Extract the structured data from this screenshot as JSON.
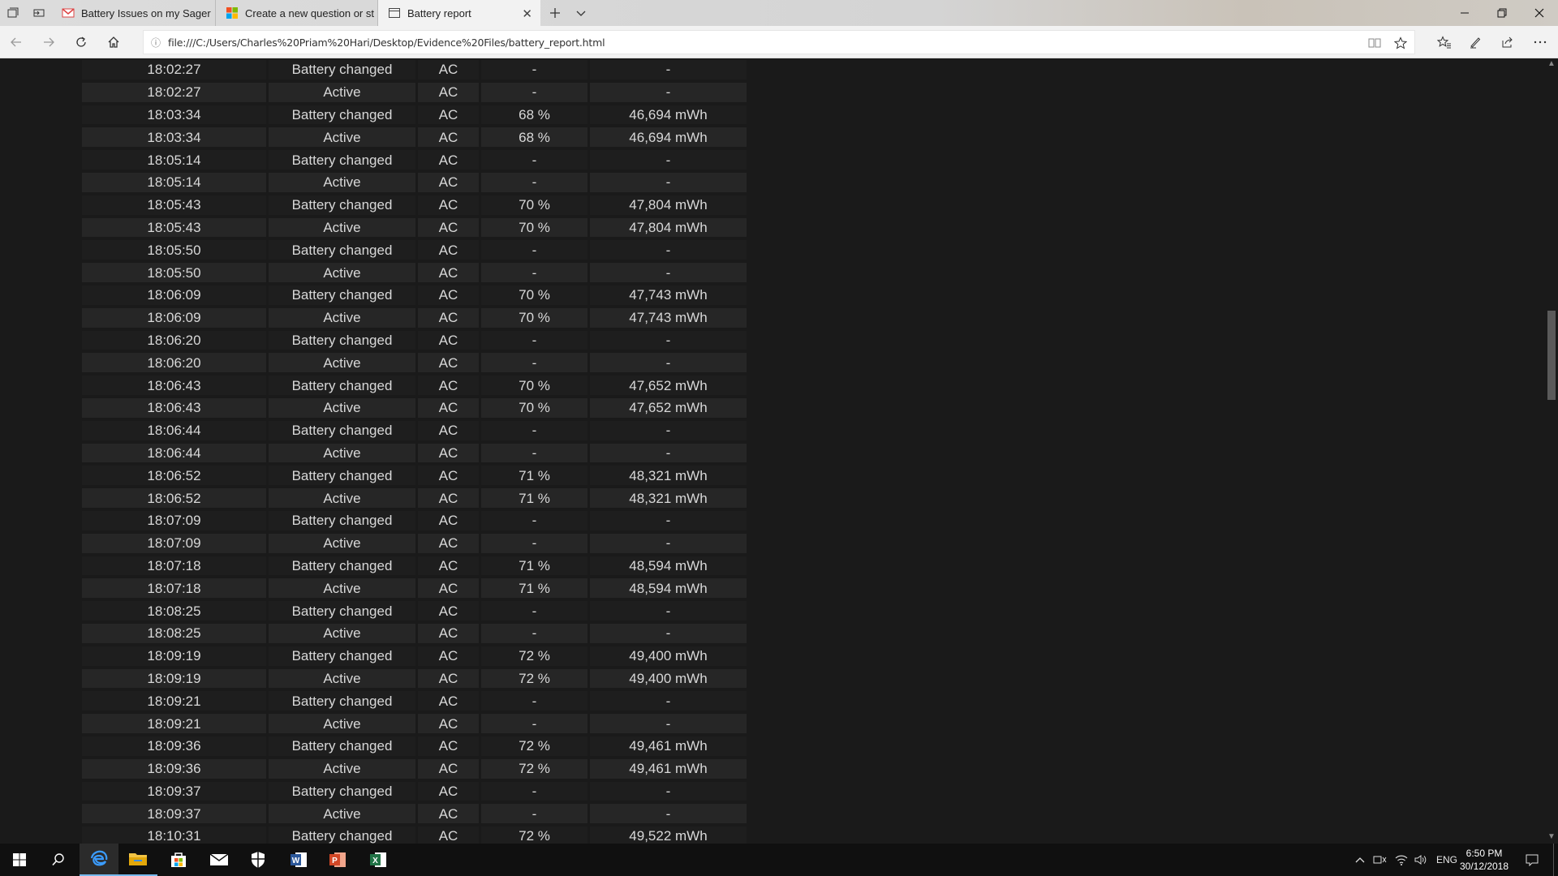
{
  "browser": {
    "tabs": [
      {
        "title": "Battery Issues on my Sager",
        "icon": "gmail-icon"
      },
      {
        "title": "Create a new question or st",
        "icon": "microsoft-icon"
      },
      {
        "title": "Battery report",
        "icon": "page-icon"
      }
    ],
    "url": "file:///C:/Users/Charles%20Priam%20Hari/Desktop/Evidence%20Files/battery_report.html"
  },
  "report": {
    "rows": [
      {
        "time": "18:02:27",
        "state": "Battery changed",
        "source": "AC",
        "percent": "-",
        "capacity": "-"
      },
      {
        "time": "18:02:27",
        "state": "Active",
        "source": "AC",
        "percent": "-",
        "capacity": "-"
      },
      {
        "time": "18:03:34",
        "state": "Battery changed",
        "source": "AC",
        "percent": "68 %",
        "capacity": "46,694 mWh"
      },
      {
        "time": "18:03:34",
        "state": "Active",
        "source": "AC",
        "percent": "68 %",
        "capacity": "46,694 mWh"
      },
      {
        "time": "18:05:14",
        "state": "Battery changed",
        "source": "AC",
        "percent": "-",
        "capacity": "-"
      },
      {
        "time": "18:05:14",
        "state": "Active",
        "source": "AC",
        "percent": "-",
        "capacity": "-"
      },
      {
        "time": "18:05:43",
        "state": "Battery changed",
        "source": "AC",
        "percent": "70 %",
        "capacity": "47,804 mWh"
      },
      {
        "time": "18:05:43",
        "state": "Active",
        "source": "AC",
        "percent": "70 %",
        "capacity": "47,804 mWh"
      },
      {
        "time": "18:05:50",
        "state": "Battery changed",
        "source": "AC",
        "percent": "-",
        "capacity": "-"
      },
      {
        "time": "18:05:50",
        "state": "Active",
        "source": "AC",
        "percent": "-",
        "capacity": "-"
      },
      {
        "time": "18:06:09",
        "state": "Battery changed",
        "source": "AC",
        "percent": "70 %",
        "capacity": "47,743 mWh"
      },
      {
        "time": "18:06:09",
        "state": "Active",
        "source": "AC",
        "percent": "70 %",
        "capacity": "47,743 mWh"
      },
      {
        "time": "18:06:20",
        "state": "Battery changed",
        "source": "AC",
        "percent": "-",
        "capacity": "-"
      },
      {
        "time": "18:06:20",
        "state": "Active",
        "source": "AC",
        "percent": "-",
        "capacity": "-"
      },
      {
        "time": "18:06:43",
        "state": "Battery changed",
        "source": "AC",
        "percent": "70 %",
        "capacity": "47,652 mWh"
      },
      {
        "time": "18:06:43",
        "state": "Active",
        "source": "AC",
        "percent": "70 %",
        "capacity": "47,652 mWh"
      },
      {
        "time": "18:06:44",
        "state": "Battery changed",
        "source": "AC",
        "percent": "-",
        "capacity": "-"
      },
      {
        "time": "18:06:44",
        "state": "Active",
        "source": "AC",
        "percent": "-",
        "capacity": "-"
      },
      {
        "time": "18:06:52",
        "state": "Battery changed",
        "source": "AC",
        "percent": "71 %",
        "capacity": "48,321 mWh"
      },
      {
        "time": "18:06:52",
        "state": "Active",
        "source": "AC",
        "percent": "71 %",
        "capacity": "48,321 mWh"
      },
      {
        "time": "18:07:09",
        "state": "Battery changed",
        "source": "AC",
        "percent": "-",
        "capacity": "-"
      },
      {
        "time": "18:07:09",
        "state": "Active",
        "source": "AC",
        "percent": "-",
        "capacity": "-"
      },
      {
        "time": "18:07:18",
        "state": "Battery changed",
        "source": "AC",
        "percent": "71 %",
        "capacity": "48,594 mWh"
      },
      {
        "time": "18:07:18",
        "state": "Active",
        "source": "AC",
        "percent": "71 %",
        "capacity": "48,594 mWh"
      },
      {
        "time": "18:08:25",
        "state": "Battery changed",
        "source": "AC",
        "percent": "-",
        "capacity": "-"
      },
      {
        "time": "18:08:25",
        "state": "Active",
        "source": "AC",
        "percent": "-",
        "capacity": "-"
      },
      {
        "time": "18:09:19",
        "state": "Battery changed",
        "source": "AC",
        "percent": "72 %",
        "capacity": "49,400 mWh"
      },
      {
        "time": "18:09:19",
        "state": "Active",
        "source": "AC",
        "percent": "72 %",
        "capacity": "49,400 mWh"
      },
      {
        "time": "18:09:21",
        "state": "Battery changed",
        "source": "AC",
        "percent": "-",
        "capacity": "-"
      },
      {
        "time": "18:09:21",
        "state": "Active",
        "source": "AC",
        "percent": "-",
        "capacity": "-"
      },
      {
        "time": "18:09:36",
        "state": "Battery changed",
        "source": "AC",
        "percent": "72 %",
        "capacity": "49,461 mWh"
      },
      {
        "time": "18:09:36",
        "state": "Active",
        "source": "AC",
        "percent": "72 %",
        "capacity": "49,461 mWh"
      },
      {
        "time": "18:09:37",
        "state": "Battery changed",
        "source": "AC",
        "percent": "-",
        "capacity": "-"
      },
      {
        "time": "18:09:37",
        "state": "Active",
        "source": "AC",
        "percent": "-",
        "capacity": "-"
      },
      {
        "time": "18:10:31",
        "state": "Battery changed",
        "source": "AC",
        "percent": "72 %",
        "capacity": "49,522 mWh"
      }
    ]
  },
  "taskbar": {
    "apps": [
      "edge-icon",
      "file-explorer-icon",
      "store-icon",
      "mail-icon",
      "defender-icon",
      "word-icon",
      "powerpoint-icon",
      "excel-icon"
    ],
    "language": "ENG",
    "time": "6:50 PM",
    "date": "30/12/2018"
  },
  "colors": {
    "page_bg": "#1a1a1a",
    "row_odd": "#1e1e1e",
    "row_even": "#262626",
    "taskbar_accent": "#76b9ed"
  }
}
